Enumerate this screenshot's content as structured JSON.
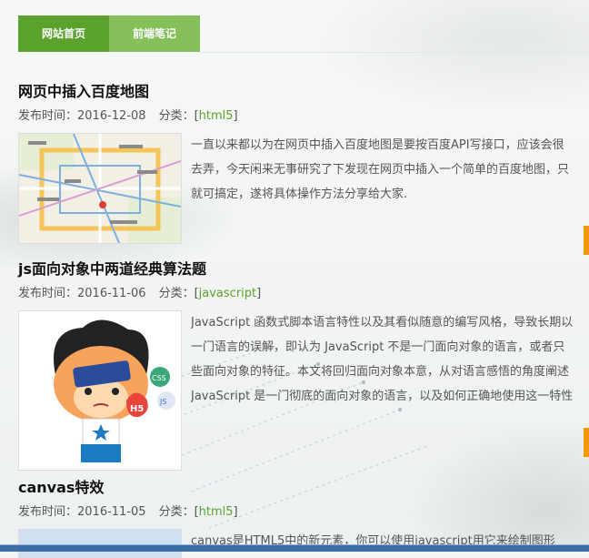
{
  "nav": {
    "tabs": [
      {
        "label": "网站首页",
        "active": true
      },
      {
        "label": "前端笔记",
        "active": false
      }
    ]
  },
  "meta_labels": {
    "date_prefix": "发布时间：",
    "category_prefix": "分类：["
  },
  "articles": [
    {
      "title": "网页中插入百度地图",
      "date": "2016-12-08",
      "category": "html5",
      "thumbnail": "map-thumbnail",
      "excerpt_lines": [
        "一直以来都以为在网页中插入百度地图是要按百度API写接口，应该会很",
        "去弄，今天闲来无事研究了下发现在网页中插入一个简单的百度地图，只",
        "就可搞定，遂将具体操作方法分享给大家."
      ]
    },
    {
      "title": "js面向对象中两道经典算法题",
      "date": "2016-11-06",
      "category": "javascript",
      "thumbnail": "cartoon-avatar-thumbnail",
      "excerpt_lines": [
        "JavaScript 函数式脚本语言特性以及其看似随意的编写风格，导致长期以",
        "一门语言的误解，即认为 JavaScript 不是一门面向对象的语言，或者只",
        "些面向对象的特征。本文将回归面向对象本意，从对语言感悟的角度阐述",
        "JavaScript 是一门彻底的面向对象的语言，以及如何正确地使用这一特性"
      ]
    },
    {
      "title": "canvas特效",
      "date": "2016-11-05",
      "category": "html5",
      "thumbnail": "canvas-thumbnail",
      "excerpt_lines": [
        "canvas是HTML5中的新元素，你可以使用javascript用它来绘制图形"
      ]
    }
  ],
  "avatar_badges": {
    "h5": "H5",
    "css": "CSS",
    "js": "JS"
  },
  "colors": {
    "nav_active": "#5aa22b",
    "nav_inactive": "#86c05a",
    "category_link": "#5aa22b",
    "accent_tab": "#f39800"
  }
}
